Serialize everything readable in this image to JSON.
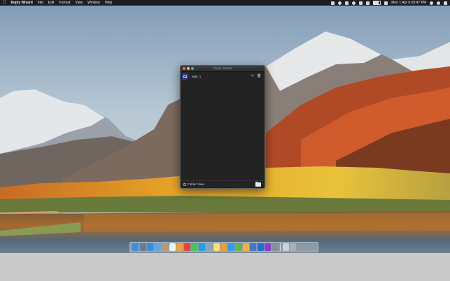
{
  "menubar": {
    "apple": "",
    "app_name": "Reply Wizard",
    "menus": [
      "File",
      "Edit",
      "Format",
      "View",
      "Window",
      "Help"
    ],
    "clock": "Mon 1 Apr  6:03:47 PM",
    "status_icons": [
      "dropbox-icon",
      "evernote-icon",
      "bluetooth-icon",
      "timemachine-icon",
      "wifi-icon",
      "volume-icon",
      "battery-icon",
      "flag-icon",
      "search-icon",
      "siri-icon",
      "notification-center-icon"
    ]
  },
  "window": {
    "title": "Reply Wizard",
    "items": [
      {
        "label": "Mail_1",
        "icon": "mail-icon"
      }
    ],
    "footer": {
      "checkbox_label": "Folder View",
      "checkbox_checked": false
    }
  },
  "dock": {
    "apps": [
      {
        "name": "finder-icon",
        "color": "#3a8ee6"
      },
      {
        "name": "launchpad-icon",
        "color": "#6c7a8a"
      },
      {
        "name": "safari-icon",
        "color": "#2f8fe8"
      },
      {
        "name": "mail-icon",
        "color": "#5aa9f0"
      },
      {
        "name": "contacts-icon",
        "color": "#b89a6e"
      },
      {
        "name": "calendar-icon",
        "color": "#f3f3f3"
      },
      {
        "name": "photos-icon",
        "color": "#f0a23a"
      },
      {
        "name": "chrome-icon",
        "color": "#e8453c"
      },
      {
        "name": "messages-icon",
        "color": "#49c35a"
      },
      {
        "name": "skype-icon",
        "color": "#19a3e0"
      },
      {
        "name": "preview-icon",
        "color": "#8fa4bc"
      },
      {
        "name": "notes-icon",
        "color": "#f4e27a"
      },
      {
        "name": "pages-icon",
        "color": "#f39b2f"
      },
      {
        "name": "app-store-icon",
        "color": "#2a9df4"
      },
      {
        "name": "maps-icon",
        "color": "#63b64e"
      },
      {
        "name": "chrome-alt-icon",
        "color": "#f2b33d"
      },
      {
        "name": "textwrangler-icon",
        "color": "#3f77c9"
      },
      {
        "name": "xcode-icon",
        "color": "#1d6fd1"
      },
      {
        "name": "podcasts-icon",
        "color": "#8a3ec7"
      },
      {
        "name": "system-preferences-icon",
        "color": "#8a8f96"
      }
    ],
    "trailing": [
      {
        "name": "downloads-folder-icon",
        "color": "#c9d3dd"
      },
      {
        "name": "trash-icon",
        "color": "#a9b0b8"
      }
    ]
  },
  "colors": {
    "menubar": "#1f1f22",
    "window_bg": "#232324",
    "accent_mail": "#2d3a83"
  }
}
